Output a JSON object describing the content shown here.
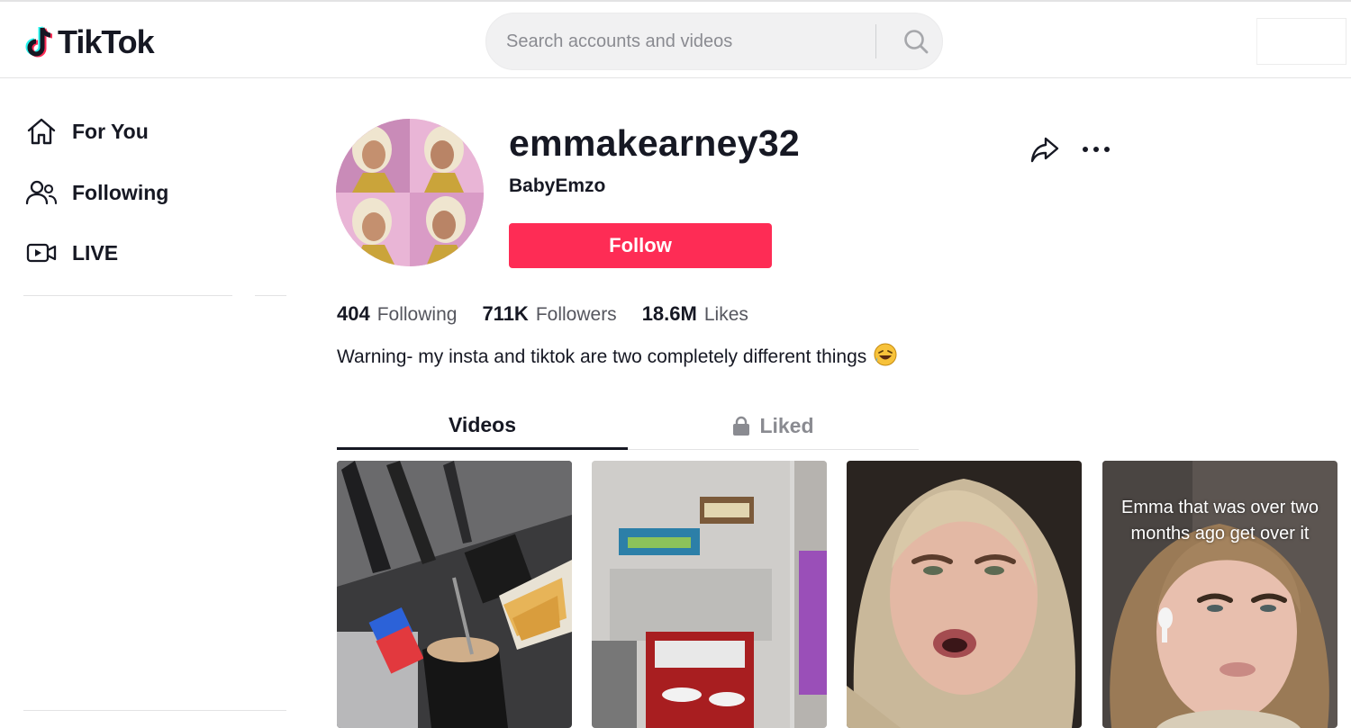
{
  "header": {
    "logo_text": "TikTok",
    "search_placeholder": "Search accounts and videos"
  },
  "sidebar": {
    "items": [
      {
        "label": "For You",
        "icon": "home-icon"
      },
      {
        "label": "Following",
        "icon": "users-icon"
      },
      {
        "label": "LIVE",
        "icon": "live-icon"
      }
    ]
  },
  "profile": {
    "username": "emmakearney32",
    "nickname": "BabyEmzo",
    "follow_label": "Follow",
    "stats": [
      {
        "value": "404",
        "label": "Following"
      },
      {
        "value": "711K",
        "label": "Followers"
      },
      {
        "value": "18.6M",
        "label": "Likes"
      }
    ],
    "bio": "Warning- my insta and tiktok are two completely different things",
    "bio_emoji": "🤣"
  },
  "tabs": {
    "videos": "Videos",
    "liked": "Liked"
  },
  "videos": [
    {
      "caption": ""
    },
    {
      "caption": ""
    },
    {
      "caption": ""
    },
    {
      "caption": "Emma that was over two months ago get over it"
    }
  ],
  "colors": {
    "brand_red": "#fe2c55",
    "text": "#161823",
    "muted": "#8a8b91"
  }
}
